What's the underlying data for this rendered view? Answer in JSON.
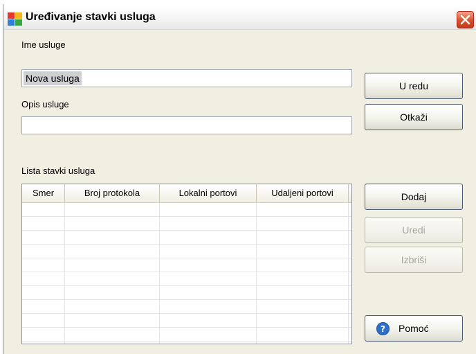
{
  "window": {
    "title": "Uređivanje stavki usluga",
    "icon": "avg-app-icon",
    "close_icon": "close-icon"
  },
  "form": {
    "name_label": "Ime usluge",
    "name_value": "Nova usluga",
    "description_label": "Opis usluge",
    "description_value": "",
    "list_label": "Lista stavki usluga"
  },
  "list": {
    "columns": [
      "Smer",
      "Broj protokola",
      "Lokalni portovi",
      "Udaljeni portovi"
    ],
    "rows": []
  },
  "buttons": {
    "ok": "U redu",
    "cancel": "Otkaži",
    "add": "Dodaj",
    "edit": "Uredi",
    "delete": "Izbriši",
    "help": "Pomoć"
  },
  "colors": {
    "dialog_background": "#f1efe2",
    "close_button": "#d8512e",
    "selection": "#cfd0d4",
    "help_icon": "#2f6fc8"
  }
}
